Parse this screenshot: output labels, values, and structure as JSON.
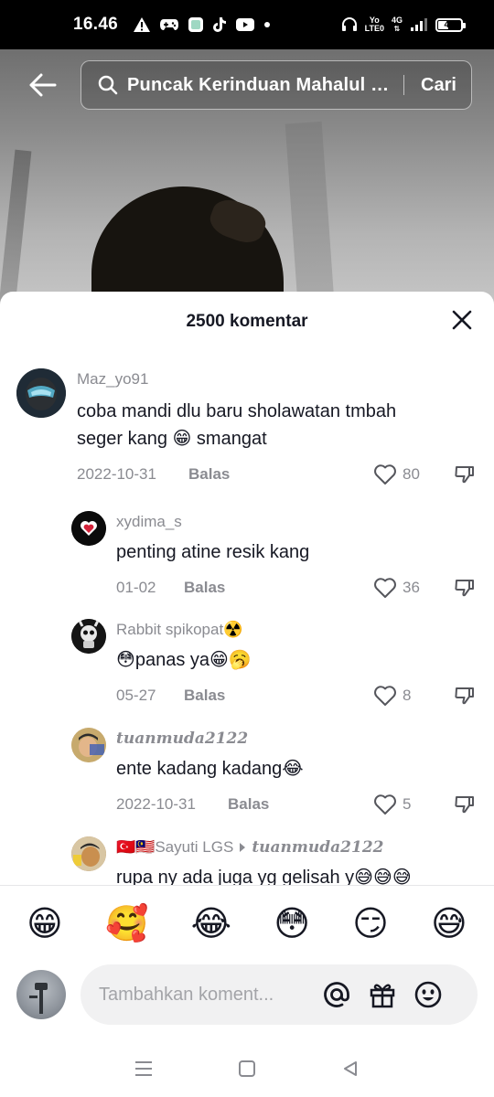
{
  "status_bar": {
    "time": "16.46",
    "network_label_top": "Yo",
    "network_label_bottom": "LTE0",
    "network_gen": "4G",
    "battery": "43",
    "battery_level": 0.43
  },
  "header": {
    "search_query": "Puncak Kerinduan Mahalul Qiyam",
    "search_button": "Cari"
  },
  "panel": {
    "title": "2500 komentar"
  },
  "comments": [
    {
      "user": "Maz_yo91",
      "text_line1": "coba mandi dlu baru sholawatan tmbah",
      "text_line2": "seger kang 😁 smangat",
      "date": "2022-10-31",
      "reply": "Balas",
      "likes": "80"
    },
    {
      "user": "xydima_s",
      "text": "penting atine resik kang",
      "date": "01-02",
      "reply": "Balas",
      "likes": "36"
    },
    {
      "user": "Rabbit spikopat☢️",
      "text": "😳panas ya😁🥱",
      "date": "05-27",
      "reply": "Balas",
      "likes": "8"
    },
    {
      "user": "tuanmuda2122",
      "text": "ente kadang kadang😂",
      "date": "2022-10-31",
      "reply": "Balas",
      "likes": "5"
    },
    {
      "user": "🇹🇷🇲🇾Sayuti LGS",
      "reply_to": "tuanmuda2122",
      "text": "rupa ny ada juga yg gelisah y😅😅😅"
    }
  ],
  "emoji_bar": [
    "😁",
    "🥰",
    "😂",
    "😳",
    "😏",
    "😅"
  ],
  "comment_input": {
    "placeholder": "Tambahkan koment..."
  },
  "icons": {
    "back": "back-arrow-icon",
    "search": "search-icon",
    "close": "close-icon",
    "like": "heart-icon",
    "dislike": "thumbs-down-icon",
    "mention": "at-icon",
    "gift": "gift-icon",
    "emoji": "smiley-icon"
  },
  "colors": {
    "text_primary": "#161823",
    "text_secondary": "#8a8b91",
    "panel_bg": "#ffffff",
    "input_bg": "#f1f1f2"
  }
}
